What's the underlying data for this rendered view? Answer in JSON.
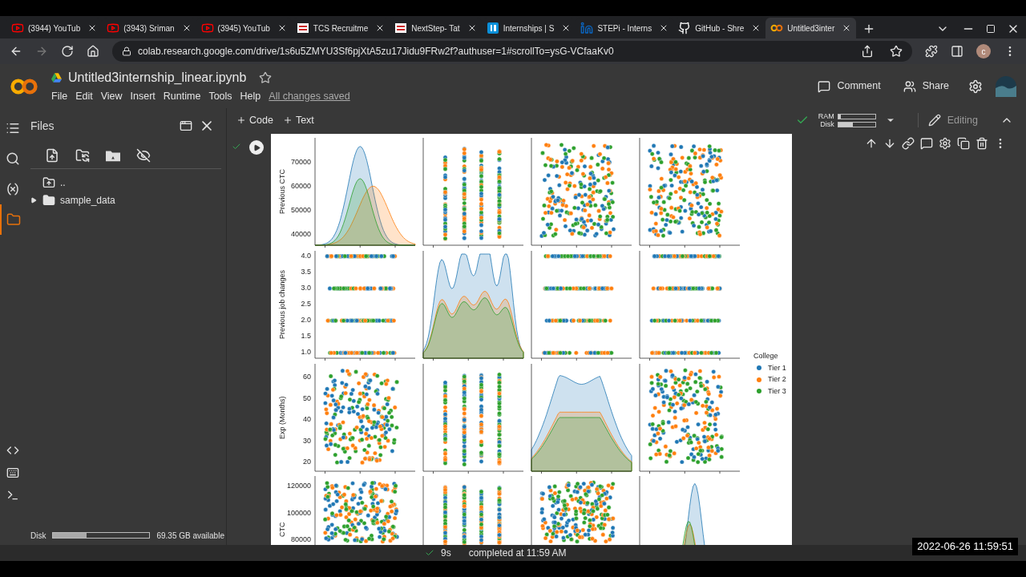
{
  "browser": {
    "tabs": [
      {
        "title": "(3944) YouTub",
        "kind": "youtube",
        "selected": false
      },
      {
        "title": "(3943) Sriman",
        "kind": "youtube",
        "selected": false
      },
      {
        "title": "(3945) YouTub",
        "kind": "youtube",
        "selected": false
      },
      {
        "title": "TCS Recruitme",
        "kind": "tcs",
        "selected": false
      },
      {
        "title": "NextStep- Tat",
        "kind": "tcs",
        "selected": false
      },
      {
        "title": "Internships | S",
        "kind": "internshala",
        "selected": false
      },
      {
        "title": "STEPi - Interns",
        "kind": "linkedin",
        "selected": false
      },
      {
        "title": "GitHub - Shre",
        "kind": "github",
        "selected": false
      },
      {
        "title": "Untitled3inter",
        "kind": "colab",
        "selected": true
      }
    ],
    "address": "colab.research.google.com/drive/1s6u5ZMYU3Sf6pjXtA5zu17Jidu9FRw2f?authuser=1#scrollTo=ysG-VCfaaKv0",
    "profile_initial": "c"
  },
  "notebook": {
    "title": "Untitled3internship_linear.ipynb",
    "menu": [
      "File",
      "Edit",
      "View",
      "Insert",
      "Runtime",
      "Tools",
      "Help"
    ],
    "save_status": "All changes saved",
    "actions": [
      "Comment",
      "Share"
    ]
  },
  "toolbar": {
    "insert": [
      "Code",
      "Text"
    ],
    "resources": [
      {
        "label": "RAM",
        "level": 0.08
      },
      {
        "label": "Disk",
        "level": 0.4
      }
    ],
    "mode": "Editing"
  },
  "rail": [
    {
      "kind": "toc",
      "selected": false
    },
    {
      "kind": "search",
      "selected": false
    },
    {
      "kind": "variables",
      "selected": false
    },
    {
      "kind": "files",
      "selected": true
    }
  ],
  "files_panel": {
    "title": "Files",
    "tree": [
      {
        "name": "..",
        "kind": "parent"
      },
      {
        "name": "sample_data",
        "kind": "folder",
        "expanded": false
      }
    ],
    "disk": {
      "label": "Disk",
      "level": 0.35,
      "reading": "69.35 GB available"
    }
  },
  "pairplot": {
    "rows": [
      {
        "label": "Previous CTC",
        "ticks": [
          "70000",
          "60000",
          "50000",
          "40000"
        ],
        "panels": [
          {
            "kind": "kde"
          },
          {
            "kind": "vstrip"
          },
          {
            "kind": "scatter"
          },
          {
            "kind": "scatter"
          }
        ]
      },
      {
        "label": "Previous job changes",
        "ticks": [
          "4.0",
          "3.5",
          "3.0",
          "2.5",
          "2.0",
          "1.5",
          "1.0"
        ],
        "panels": [
          {
            "kind": "hstrip"
          },
          {
            "kind": "kde"
          },
          {
            "kind": "hstrip"
          },
          {
            "kind": "hstrip"
          }
        ]
      },
      {
        "label": "Exp (Months)",
        "ticks": [
          "60",
          "50",
          "40",
          "30",
          "20"
        ],
        "panels": [
          {
            "kind": "scatter"
          },
          {
            "kind": "vstrip"
          },
          {
            "kind": "kde"
          },
          {
            "kind": "scatter"
          }
        ]
      },
      {
        "label": "CTC",
        "ticks": [
          "120000",
          "100000",
          "80000"
        ],
        "panels": [
          {
            "kind": "scatter"
          },
          {
            "kind": "vstrip"
          },
          {
            "kind": "scatter"
          },
          {
            "kind": "kde"
          }
        ]
      }
    ],
    "legend": {
      "title": "College",
      "items": [
        {
          "label": "Tier 1",
          "color": "#1f77b4"
        },
        {
          "label": "Tier 2",
          "color": "#ff7f0e"
        },
        {
          "label": "Tier 3",
          "color": "#2ca02c"
        }
      ]
    }
  },
  "status_bar": {
    "duration": "9s",
    "text": "completed at 11:59 AM"
  },
  "timestamp": "2022-06-26 11:59:51"
}
